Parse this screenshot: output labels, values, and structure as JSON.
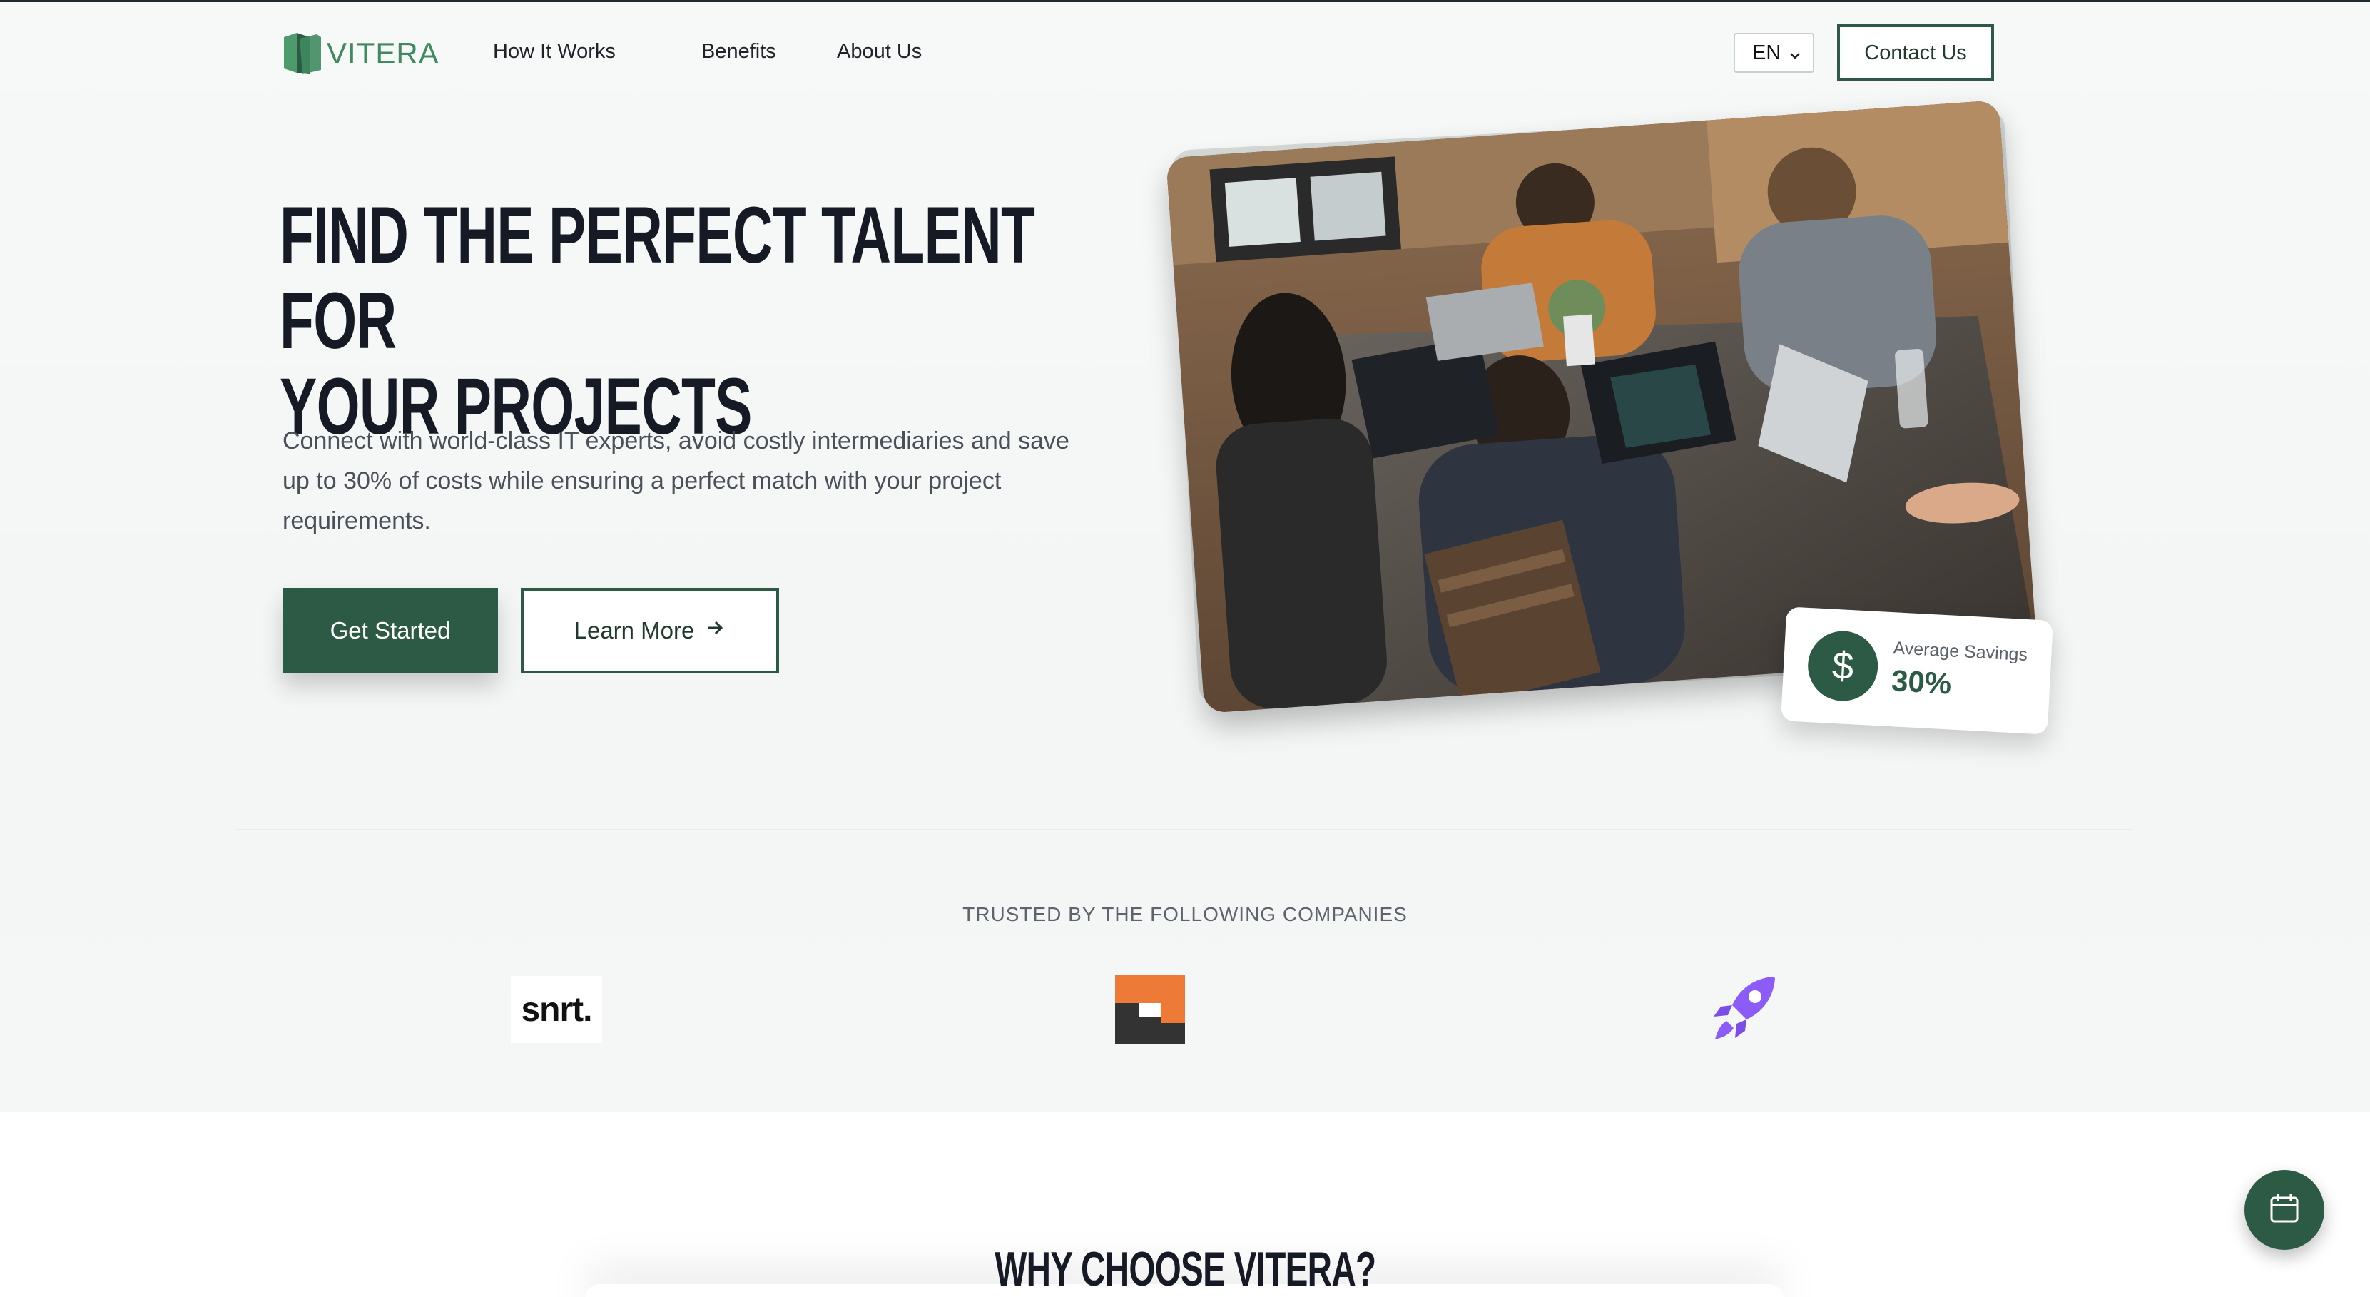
{
  "header": {
    "logo_text": "VITERA",
    "nav": [
      "How It Works",
      "Benefits",
      "About Us"
    ],
    "language": "EN",
    "contact_label": "Contact Us"
  },
  "hero": {
    "title_line1": "FIND THE PERFECT TALENT FOR",
    "title_line2": "YOUR PROJECTS",
    "subtitle": "Connect with world-class IT experts, avoid costly intermediaries and save up to 30% of costs while ensuring a perfect match with your project requirements.",
    "primary_cta": "Get Started",
    "secondary_cta": "Learn More",
    "savings_label": "Average Savings",
    "savings_value": "30%"
  },
  "trusted": {
    "heading": "TRUSTED BY THE FOLLOWING COMPANIES",
    "companies": [
      "snrt."
    ]
  },
  "why": {
    "title": "WHY CHOOSE VITERA?"
  },
  "colors": {
    "brand_green": "#2d5a44",
    "logo_green": "#3f8a5e",
    "accent_orange": "#ee7a38",
    "accent_purple": "#8b5cf6"
  },
  "icons": {
    "savings": "dollar-icon",
    "learn_more": "arrow-right-icon",
    "language": "chevron-down-icon",
    "floating": "calendar-icon"
  }
}
